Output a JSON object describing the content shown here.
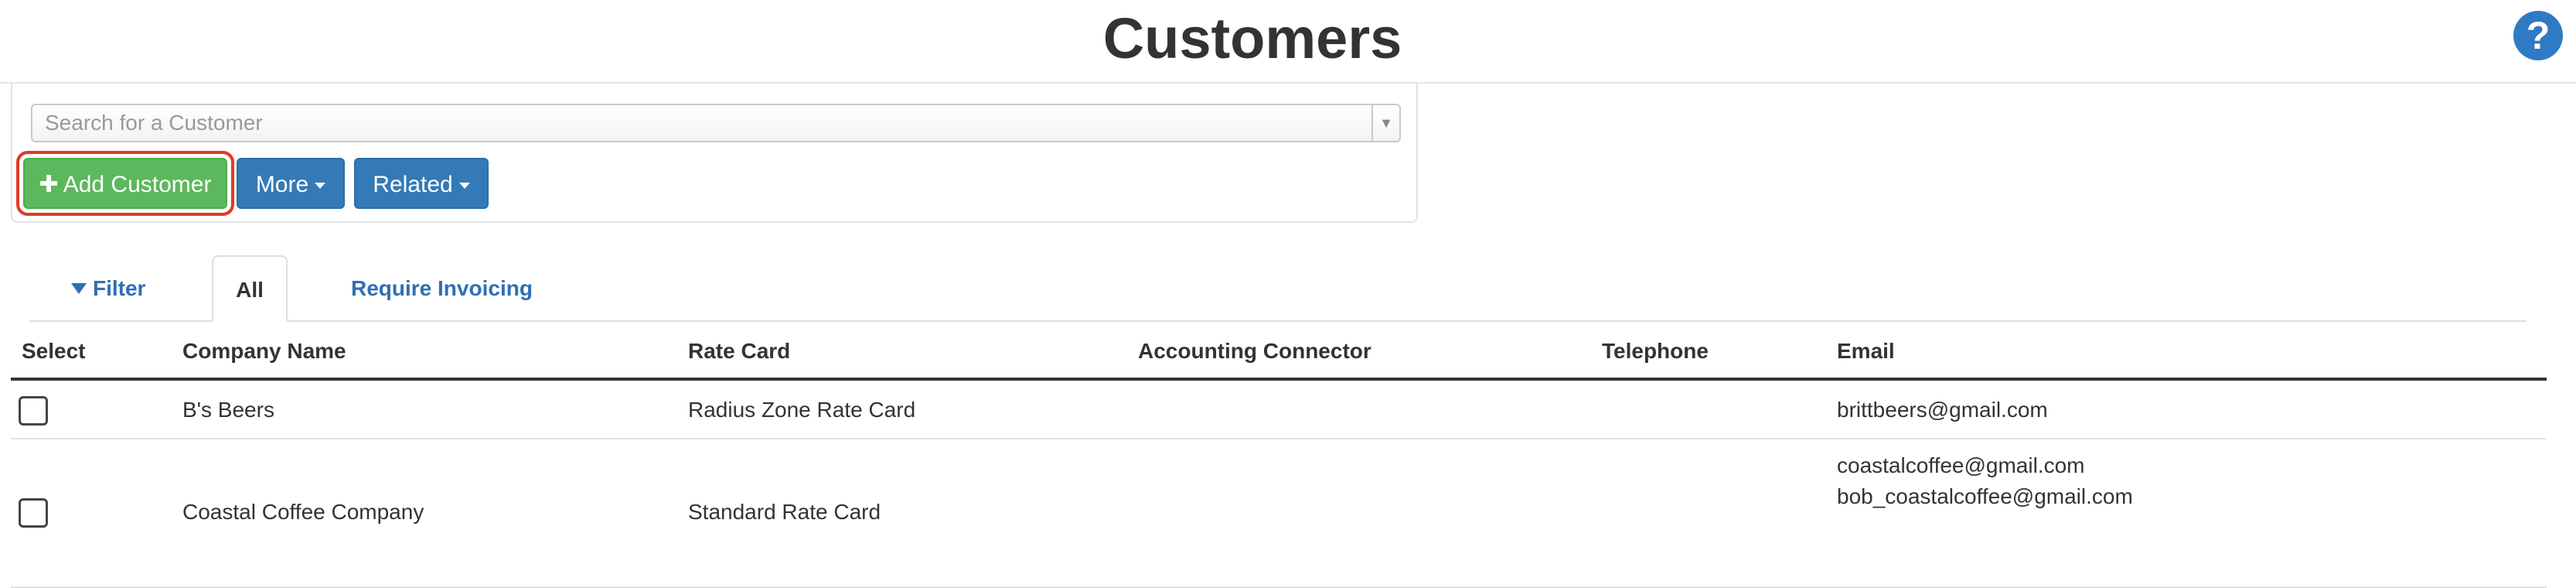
{
  "header": {
    "title": "Customers",
    "help_label": "?"
  },
  "search": {
    "placeholder": "Search for a Customer",
    "value": ""
  },
  "toolbar": {
    "add_label": "Add Customer",
    "more_label": "More",
    "related_label": "Related"
  },
  "tabs": {
    "filter": "Filter",
    "all": "All",
    "require_invoicing": "Require Invoicing",
    "active": "All"
  },
  "table": {
    "columns": [
      "Select",
      "Company Name",
      "Rate Card",
      "Accounting Connector",
      "Telephone",
      "Email"
    ],
    "rows": [
      {
        "company": "B's Beers",
        "rate_card": "Radius Zone Rate Card",
        "accounting_connector": "",
        "telephone": "",
        "emails": [
          "brittbeers@gmail.com"
        ]
      },
      {
        "company": "Coastal Coffee Company",
        "rate_card": "Standard Rate Card",
        "accounting_connector": "",
        "telephone": "",
        "emails": [
          "coastalcoffee@gmail.com",
          "bob_coastalcoffee@gmail.com"
        ]
      }
    ]
  },
  "colors": {
    "primary": "#337ab7",
    "success": "#5cb85c",
    "highlight": "#e03b26",
    "link": "#2f6fb3"
  }
}
